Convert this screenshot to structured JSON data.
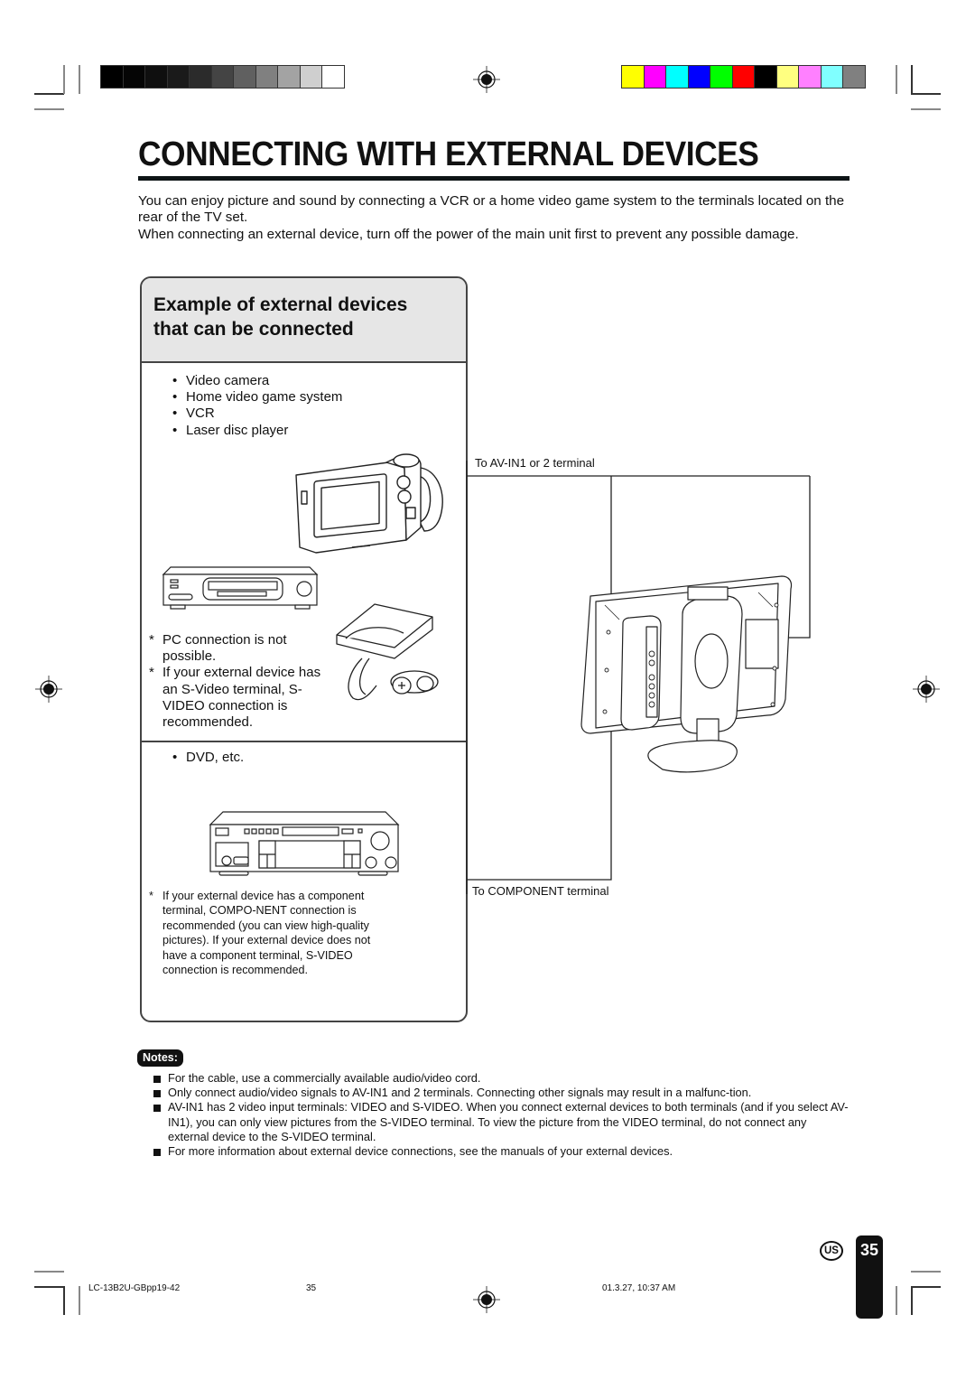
{
  "print_marks": {
    "grayscale_bar": [
      "#000000",
      "#050505",
      "#0f0f0f",
      "#1a1a1a",
      "#2b2b2b",
      "#444444",
      "#606060",
      "#808080",
      "#a3a3a3",
      "#cfcfcf",
      "#ffffff"
    ],
    "color_bar": [
      "#ffff00",
      "#ff00ff",
      "#00ffff",
      "#0000ff",
      "#00ff00",
      "#ff0000",
      "#000000",
      "#ffff80",
      "#ff80ff",
      "#80ffff",
      "#808080"
    ]
  },
  "page": {
    "title": "CONNECTING WITH EXTERNAL DEVICES",
    "intro": [
      "You can enjoy picture and sound by connecting a VCR or a home video game system to the terminals located on the rear of the TV set.",
      "When connecting an external device, turn off the power of the main unit first to prevent any possible damage."
    ]
  },
  "panel": {
    "heading_line1": "Example of external devices",
    "heading_line2": "that can be connected",
    "devices": [
      "Video camera",
      "Home video game system",
      "VCR",
      "Laser disc player"
    ],
    "av_notes": [
      "PC connection is not possible.",
      "If your external device has an S-Video terminal, S-VIDEO connection is recommended."
    ],
    "component_devices": [
      "DVD, etc."
    ],
    "component_note": "If your external device has a component terminal, COMPO-NENT connection is recommended (you can view high-quality pictures). If your external device does not have a component terminal, S-VIDEO connection is recommended.",
    "illustrations": [
      "video-camera",
      "vcr",
      "game-console",
      "dvd-player"
    ]
  },
  "diagram": {
    "label_av": "To AV-IN1 or 2 terminal",
    "label_component": "To COMPONENT terminal",
    "illustration": "tv-rear-view"
  },
  "notes": {
    "badge": "Notes:",
    "items": [
      "For the cable, use a commercially available audio/video cord.",
      "Only connect audio/video signals to AV-IN1 and 2 terminals. Connecting other signals may result in a malfunc-tion.",
      "AV-IN1 has 2 video input terminals: VIDEO and S-VIDEO. When you connect external devices to both terminals (and if you select AV-IN1), you can only view pictures from the S-VIDEO terminal. To view the picture from the VIDEO terminal, do not connect any external device to the S-VIDEO terminal.",
      "For more information about external device connections, see the manuals of your external devices."
    ]
  },
  "footer": {
    "region": "US",
    "page_number": "35",
    "file_name": "LC-13B2U-GBpp19-42",
    "file_page": "35",
    "timestamp": "01.3.27, 10:37 AM"
  }
}
